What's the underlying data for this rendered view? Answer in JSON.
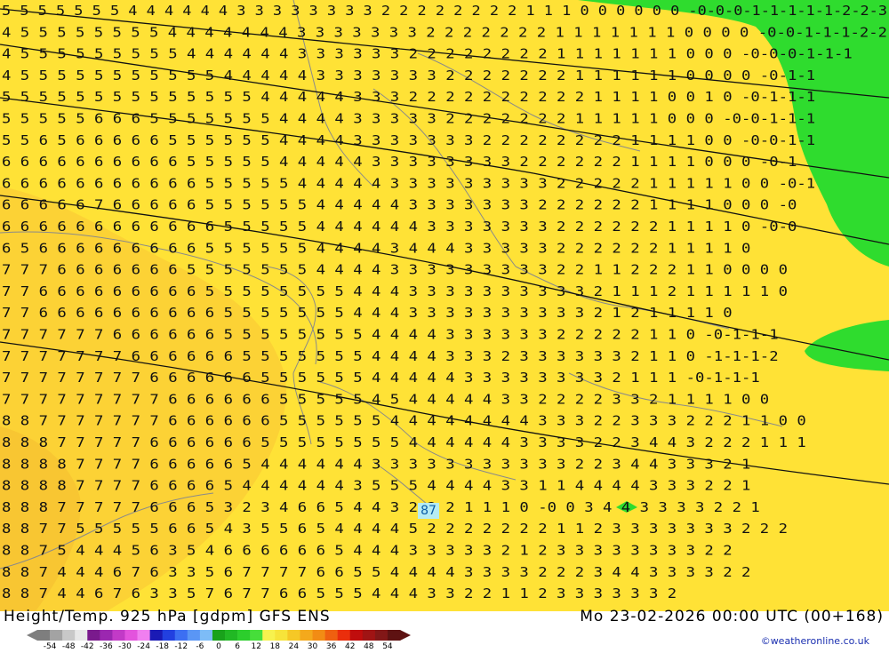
{
  "map": {
    "title": "Height/Temp. 925 hPa [gdpm] GFS ENS",
    "valid_time": "Mo 23-02-2026 00:00 UTC (00+168)",
    "credit": "©weatheronline.co.uk",
    "station_value": "87",
    "colors": {
      "background": "#ffe236",
      "warm": "#fcd235",
      "cold": "#2fdc2e",
      "contour": "#111111",
      "border": "#8a8a8a"
    },
    "label_rows": [
      "5 5 5 5 5 5 5 4 4 4 4 4 4 3 3 3 3 3 3 3 3 2 2 2 2 2 2 2 2 1 1 1 0 0 0 0 0 0 -0-0-0-1-1-1-1-1-2-2-3",
      "4 5 5 5 5 5 5 5 5 4 4 4 4 4 4 4 3 3 3 3 3 3 3 2 2 2 2 2 2 2 1 1 1 1 1 1 1 0 0 0 0 -0-0-1-1-1-2-2",
      "4 5 5 5 5 5 5 5 5 5 4 4 4 4 4 4 3 3 3 3 3 3 2 2 2 2 2 2 2 2 1 1 1 1 1 1 1 0 0 0 -0-0-0-1-1-1",
      "4 5 5 5 5 5 5 5 5 5 5 5 4 4 4 4 4 3 3 3 3 3 3 3 2 2 2 2 2 2 2 1 1 1 1 1 1 0 0 0 0 -0-1-1",
      "5 5 5 5 5 5 5 5 5 5 5 5 5 5 4 4 4 4 4 3 3 3 2 2 2 2 2 2 2 2 2 2 1 1 1 1 0 0 1 0 -0-1-1-1",
      "5 5 5 5 5 6 6 6 5 5 5 5 5 5 5 4 4 4 4 3 3 3 3 3 2 2 2 2 2 2 2 1 1 1 1 1 0 0 0 -0-0-1-1-1",
      "5 5 6 5 6 6 6 6 6 5 5 5 5 5 5 4 4 4 4 3 3 3 3 3 3 3 2 2 2 2 2 2 2 2 1 1 1 1 0 0 -0-0-1-1",
      "6 6 6 6 6 6 6 6 6 6 5 5 5 5 5 4 4 4 4 4 3 3 3 3 3 3 3 3 2 2 2 2 2 2 1 1 1 1 0 0 0 -0-1",
      "6 6 6 6 6 6 6 6 6 6 6 5 5 5 5 5 4 4 4 4 4 3 3 3 3 3 3 3 3 3 2 2 2 2 2 1 1 1 1 1 0 0 -0-1",
      "6 6 6 6 6 7 6 6 6 6 6 5 5 5 5 5 5 4 4 4 4 4 3 3 3 3 3 3 3 2 2 2 2 2 2 1 1 1 1 0 0 0 -0",
      "6 6 6 6 6 6 6 6 6 6 6 6 5 5 5 5 5 4 4 4 4 4 4 3 3 3 3 3 3 3 2 2 2 2 2 2 1 1 1 1 0 -0-0",
      "6 5 6 6 6 6 6 6 6 6 6 5 5 5 5 5 5 4 4 4 4 3 4 4 4 3 3 3 3 3 2 2 2 2 2 2 1 1 1 1 0",
      "7 7 7 6 6 6 6 6 6 6 5 5 5 5 5 5 5 4 4 4 4 3 3 3 3 3 3 3 3 3 2 2 1 1 2 2 2 1 1 0 0 0 0",
      "7 7 6 6 6 6 6 6 6 6 6 5 5 5 5 5 5 5 5 4 4 4 3 3 3 3 3 3 3 3 3 3 2 1 1 1 2 1 1 1 1 1 0",
      "7 7 6 6 6 6 6 6 6 6 6 6 5 5 5 5 5 5 5 4 4 4 3 3 3 3 3 3 3 3 3 3 2 1 2 1 1 1 1 0",
      "7 7 7 7 7 7 6 6 6 6 6 6 5 5 5 5 5 5 5 5 4 4 4 4 3 3 3 3 3 3 2 2 2 2 2 1 1 0 -0-1-1-1",
      "7 7 7 7 7 7 7 6 6 6 6 6 6 5 5 5 5 5 5 5 4 4 4 4 3 3 3 2 3 3 3 3 3 3 2 1 1 0 -1-1-1-2",
      "7 7 7 7 7 7 7 7 6 6 6 6 6 6 5 5 5 5 5 5 4 4 4 4 4 3 3 3 3 3 3 3 3 2 1 1 1 -0-1-1-1",
      "7 7 7 7 7 7 7 7 7 6 6 6 6 6 6 5 5 5 5 5 4 5 4 4 4 4 4 3 3 2 2 2 2 3 3 2 1 1 1 1 0 0",
      "8 8 7 7 7 7 7 7 7 6 6 6 6 6 6 5 5 5 5 5 5 4 4 4 4 4 4 4 4 3 3 3 2 2 3 3 3 2 2 2 1 1 0 0",
      "8 8 8 7 7 7 7 7 6 6 6 6 6 6 5 5 5 5 5 5 5 5 4 4 4 4 4 4 3 3 3 3 2 2 3 4 4 3 2 2 2 1 1 1",
      "8 8 8 8 7 7 7 7 6 6 6 6 6 5 4 4 4 4 4 4 3 3 3 3 3 3 3 3 3 3 3 2 2 3 4 4 3 3 3 2 1",
      "8 8 8 8 7 7 7 7 6 6 6 6 5 4 4 4 4 4 4 3 5 5 5 4 4 4 4 3 3 1 1 4 4 4 4 3 3 3 2 2 1",
      "8 8 8 7 7 7 7 7 6 6 6 5 3 2 3 4 6 6 5 4 4 3 2 2 2 1 1 1 0 -0 0 3 4 4 3 3 3 3 2 2 1",
      "8 8 7 7 5 5 5 5 5 6 6 5 4 3 5 5 6 5 4 4 4 4 5 2 2 2 2 2 2 2 1 1 2 3 3 3 3 3 3 3 2 2 2",
      "8 8 7 5 4 4 4 5 6 3 5 4 6 6 6 6 6 6 5 4 4 4 3 3 3 3 3 2 1 2 3 3 3 3 3 3 3 3 2 2",
      "8 8 7 4 4 4 6 7 6 3 3 5 6 7 7 7 7 6 6 5 5 4 4 4 4 3 3 3 3 2 2 2 3 4 4 3 3 3 3 2 2",
      "8 8 7 4 4 6 7 6 3 3 5 7 6 7 7 6 6 5 5 5 4 4 4 3 3 2 2 1 1 2 3 3 3 3 3 3 2"
    ]
  },
  "legend": {
    "colors": [
      "#7e7e7e",
      "#a3a3a3",
      "#c8c8c8",
      "#e8e8e8",
      "#7a1a8d",
      "#9b27b0",
      "#c23ac7",
      "#e353dd",
      "#f07ff0",
      "#1a1ab5",
      "#2240e0",
      "#3c6ff2",
      "#5a96f5",
      "#7dbcf7",
      "#19a21b",
      "#21b824",
      "#2cce2c",
      "#46de3a",
      "#f7f24e",
      "#f7e43a",
      "#f6c826",
      "#f4a91c",
      "#f28c14",
      "#ef6010",
      "#ea2e0c",
      "#c00d0d",
      "#a01414",
      "#821717",
      "#5e1212"
    ],
    "ticks": [
      "-54",
      "-48",
      "-42",
      "-36",
      "-30",
      "-24",
      "-18",
      "-12",
      "-6",
      "0",
      "6",
      "12",
      "18",
      "24",
      "30",
      "36",
      "42",
      "48",
      "54"
    ]
  }
}
